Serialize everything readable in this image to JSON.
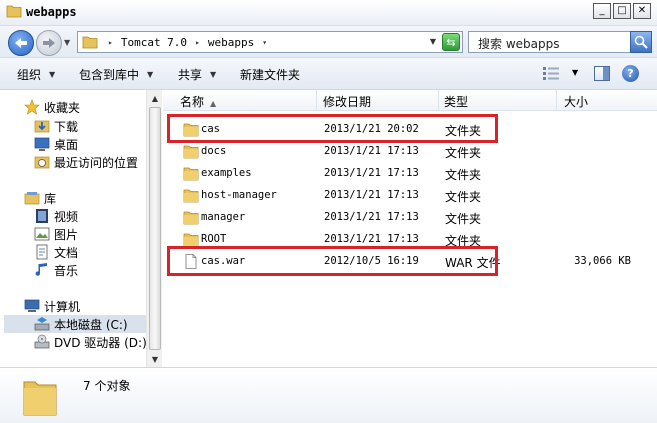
{
  "window": {
    "title": "webapps"
  },
  "address": {
    "crumbs": [
      "Tomcat 7.0",
      "webapps"
    ]
  },
  "search": {
    "placeholder": "搜索 webapps"
  },
  "toolbar": {
    "organize": "组织",
    "include_in_library": "包含到库中",
    "share": "共享",
    "new_folder": "新建文件夹"
  },
  "sidebar": {
    "favorites": "收藏夹",
    "downloads": "下载",
    "desktop": "桌面",
    "recent": "最近访问的位置",
    "libraries": "库",
    "videos": "视频",
    "pictures": "图片",
    "documents": "文档",
    "music": "音乐",
    "computer": "计算机",
    "local_disk": "本地磁盘 (C:)",
    "dvd_drive": "DVD 驱动器 (D:)"
  },
  "columns": {
    "name": "名称",
    "modified": "修改日期",
    "type": "类型",
    "size": "大小"
  },
  "files": [
    {
      "name": "cas",
      "date": "2013/1/21 20:02",
      "type": "文件夹",
      "size": "",
      "icon": "folder-icon"
    },
    {
      "name": "docs",
      "date": "2013/1/21 17:13",
      "type": "文件夹",
      "size": "",
      "icon": "folder-icon"
    },
    {
      "name": "examples",
      "date": "2013/1/21 17:13",
      "type": "文件夹",
      "size": "",
      "icon": "folder-icon"
    },
    {
      "name": "host-manager",
      "date": "2013/1/21 17:13",
      "type": "文件夹",
      "size": "",
      "icon": "folder-icon"
    },
    {
      "name": "manager",
      "date": "2013/1/21 17:13",
      "type": "文件夹",
      "size": "",
      "icon": "folder-icon"
    },
    {
      "name": "ROOT",
      "date": "2013/1/21 17:13",
      "type": "文件夹",
      "size": "",
      "icon": "folder-icon"
    },
    {
      "name": "cas.war",
      "date": "2012/10/5 16:19",
      "type": "WAR 文件",
      "size": "33,066 KB",
      "icon": "file-icon"
    }
  ],
  "details": {
    "count_text": "7 个对象"
  },
  "colors": {
    "highlight": "#d8232a",
    "folder": "#e8c15a",
    "selection": "#d8e1ec"
  }
}
